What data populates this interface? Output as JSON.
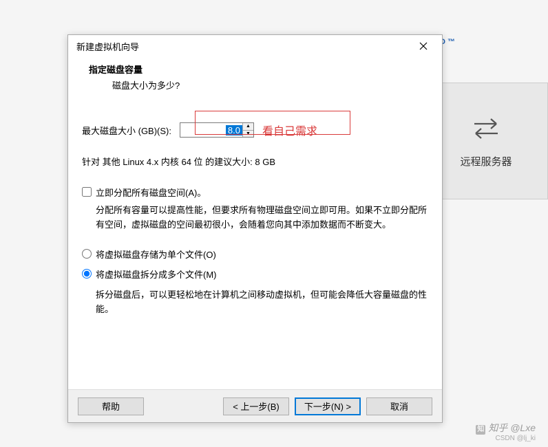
{
  "background": {
    "remote_label": "远程服务器",
    "tm": "O ™"
  },
  "dialog": {
    "title": "新建虚拟机向导",
    "header_title": "指定磁盘容量",
    "header_sub": "磁盘大小为多少?",
    "size_label": "最大磁盘大小 (GB)(S):",
    "size_value": "8.0",
    "annotation": "看自己需求",
    "recommend": "针对 其他 Linux 4.x 内核 64 位 的建议大小: 8 GB",
    "allocate_now": "立即分配所有磁盘空间(A)。",
    "allocate_desc": "分配所有容量可以提高性能，但要求所有物理磁盘空间立即可用。如果不立即分配所有空间，虚拟磁盘的空间最初很小，会随着您向其中添加数据而不断变大。",
    "radio_single": "将虚拟磁盘存储为单个文件(O)",
    "radio_split": "将虚拟磁盘拆分成多个文件(M)",
    "split_desc": "拆分磁盘后，可以更轻松地在计算机之间移动虚拟机，但可能会降低大容量磁盘的性能。",
    "buttons": {
      "help": "帮助",
      "back": "< 上一步(B)",
      "next": "下一步(N) >",
      "cancel": "取消"
    }
  },
  "watermark": {
    "main": "知乎 @Lxe",
    "sub": "CSDN @lj_ki"
  }
}
